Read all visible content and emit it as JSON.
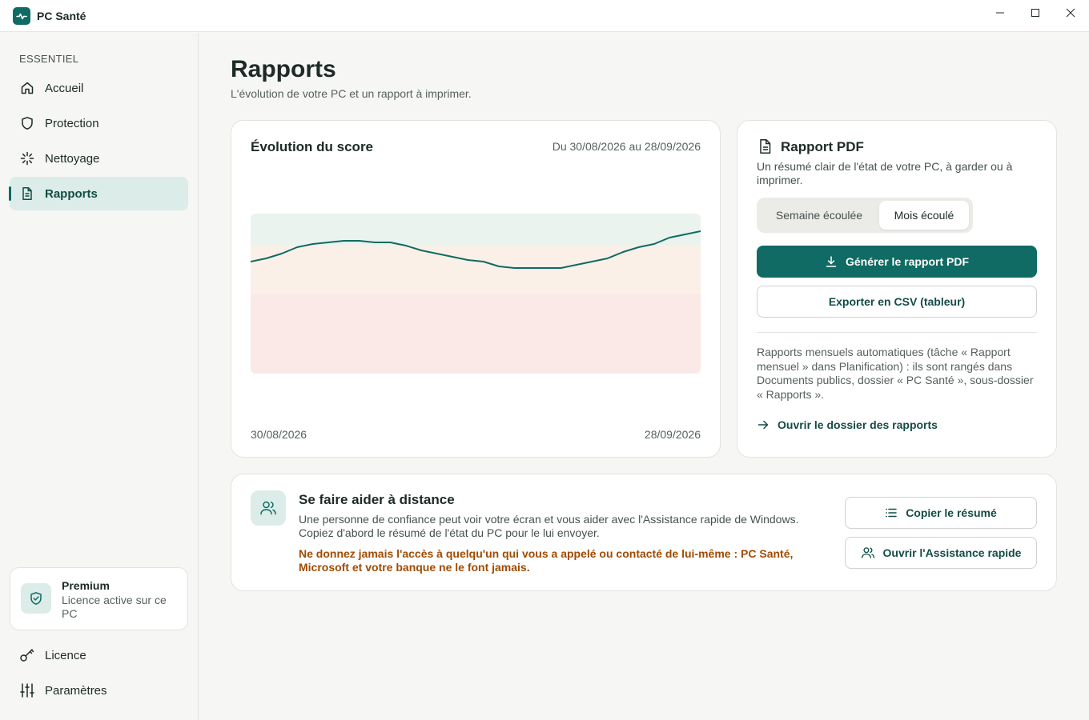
{
  "window": {
    "title": "PC Santé",
    "controls": [
      "minimize-icon",
      "maximize-icon",
      "close-icon"
    ]
  },
  "sidebar": {
    "section_label": "ESSENTIEL",
    "items": [
      {
        "label": "Accueil",
        "icon": "home-icon"
      },
      {
        "label": "Protection",
        "icon": "shield-icon"
      },
      {
        "label": "Nettoyage",
        "icon": "sparkle-icon"
      },
      {
        "label": "Rapports",
        "icon": "document-icon",
        "active": true
      }
    ],
    "premium": {
      "title": "Premium",
      "subtitle": "Licence active sur ce PC",
      "icon": "shield-check-icon"
    },
    "bottom_items": [
      {
        "label": "Licence",
        "icon": "key-icon"
      },
      {
        "label": "Paramètres",
        "icon": "sliders-icon"
      }
    ]
  },
  "page": {
    "title": "Rapports",
    "subtitle": "L'évolution de votre PC et un rapport à imprimer."
  },
  "score_card": {
    "title": "Évolution du score",
    "date_range": "Du 30/08/2026 au 28/09/2026",
    "x_start": "30/08/2026",
    "x_end": "28/09/2026"
  },
  "chart_data": {
    "type": "line",
    "title": "Évolution du score",
    "x": [
      "30/08/2026",
      "28/09/2026"
    ],
    "series": [
      {
        "values": [
          70,
          72,
          75,
          79,
          81,
          82,
          83,
          83,
          82,
          82,
          80,
          77,
          75,
          73,
          71,
          70,
          67,
          66,
          66,
          66,
          66,
          68,
          70,
          72,
          76,
          79,
          81,
          85,
          87,
          89
        ]
      }
    ],
    "ylim": [
      0,
      100
    ],
    "bands": [
      {
        "from": 80,
        "to": 100,
        "color": "#eaf3ee"
      },
      {
        "from": 50,
        "to": 80,
        "color": "#faf0e8"
      },
      {
        "from": 0,
        "to": 50,
        "color": "#fbe9e7"
      }
    ],
    "line_color": "#0f6b63",
    "grid": false
  },
  "pdf_card": {
    "title": "Rapport PDF",
    "icon": "document-icon",
    "description": "Un résumé clair de l'état de votre PC, à garder ou à imprimer.",
    "segments": [
      "Semaine écoulée",
      "Mois écoulé"
    ],
    "selected_segment": "Mois écoulé",
    "generate_label": "Générer le rapport PDF",
    "csv_label": "Exporter en CSV (tableur)",
    "note": "Rapports mensuels automatiques (tâche « Rapport mensuel » dans Planification) : ils sont rangés dans Documents publics, dossier « PC Santé », sous-dossier « Rapports ».",
    "link_label": "Ouvrir le dossier des rapports"
  },
  "help_card": {
    "title": "Se faire aider à distance",
    "icon": "users-icon",
    "description": "Une personne de confiance peut voir votre écran et vous aider avec l'Assistance rapide de Windows. Copiez d'abord le résumé de l'état du PC pour le lui envoyer.",
    "warning": "Ne donnez jamais l'accès à quelqu'un qui vous a appelé ou contacté de lui-même : PC Santé, Microsoft et votre banque ne le font jamais.",
    "copy_label": "Copier le résumé",
    "assist_label": "Ouvrir l'Assistance rapide"
  },
  "colors": {
    "accent": "#0f6b63",
    "accent_light": "#dcece8",
    "warning": "#a04b00",
    "background": "#f6f6f4"
  }
}
